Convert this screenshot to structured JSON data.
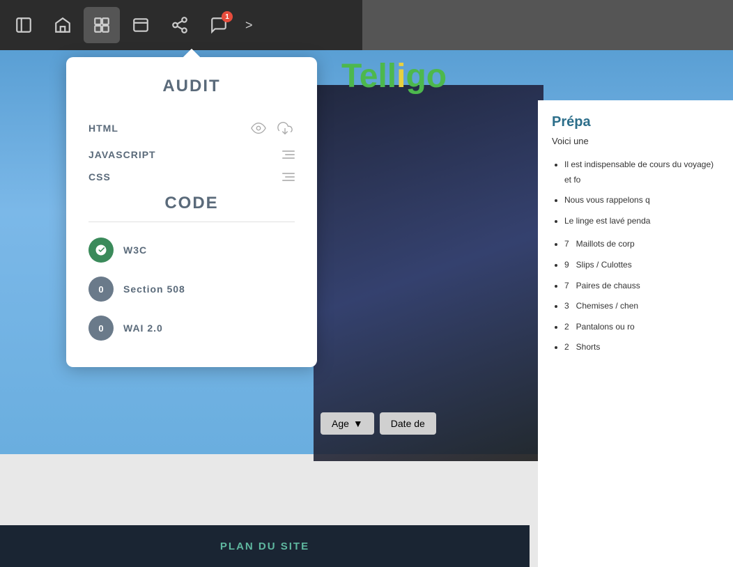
{
  "toolbar": {
    "buttons": [
      {
        "id": "sidebar-toggle",
        "icon": "sidebar",
        "active": false
      },
      {
        "id": "home",
        "icon": "home",
        "active": false
      },
      {
        "id": "components",
        "icon": "components",
        "active": true
      },
      {
        "id": "window",
        "icon": "window",
        "active": false
      },
      {
        "id": "share",
        "icon": "share",
        "active": false
      },
      {
        "id": "chat",
        "icon": "chat",
        "active": false,
        "badge": "1"
      }
    ],
    "more_label": ">"
  },
  "audit_panel": {
    "title": "AUDIT",
    "html_label": "HTML",
    "javascript_label": "JAVASCRIPT",
    "css_label": "CSS",
    "code_section_title": "CODE",
    "w3c_label": "W3C",
    "w3c_badge": "",
    "section508_label": "Section 508",
    "section508_badge": "0",
    "wai_label": "WAI 2.0",
    "wai_badge": "0"
  },
  "website": {
    "logo_text": "Telligo",
    "heading": "Prépa",
    "subtitle": "Voici une",
    "bullet1": "Il est indispensable de",
    "bullet1_cont": "cours du voyage) et fo",
    "bullet2": "Nous vous rappelons q",
    "bullet3": "Le linge est lavé penda",
    "list": [
      {
        "qty": "7",
        "item": "Maillots de corp"
      },
      {
        "qty": "9",
        "item": "Slips / Culottes"
      },
      {
        "qty": "7",
        "item": "Paires de chauss"
      },
      {
        "qty": "3",
        "item": "Chemises / chen"
      },
      {
        "qty": "2",
        "item": "Pantalons ou ro"
      },
      {
        "qty": "2",
        "item": "Shorts"
      }
    ],
    "age_dropdown": "Age",
    "date_dropdown": "Date de",
    "footer_text": "PLAN DU SITE"
  }
}
